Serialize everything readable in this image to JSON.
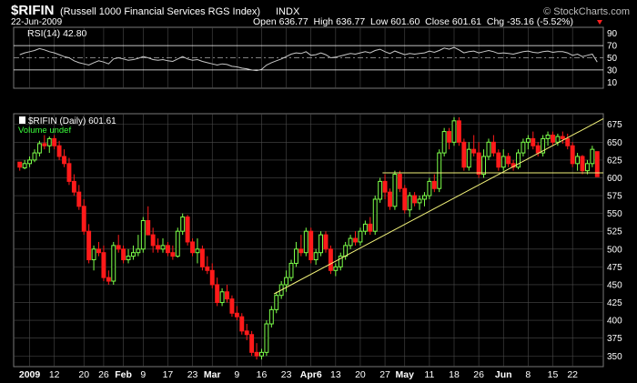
{
  "header": {
    "symbol": "$RIFIN",
    "name": "(Russell 1000 Financial Services RGS Index)",
    "exchange": "INDX",
    "watermark": "© StockCharts.com",
    "date": "22-Jun-2009",
    "quote_line": "Open 636.77  High 636.77  Low 601.60  Close 601.61  Chg -35.16 (-5.52%)"
  },
  "rsi": {
    "label": "RSI(14) 42.80",
    "levels": [
      70,
      50,
      30
    ],
    "ticks": [
      "90",
      "70",
      "50",
      "30",
      "10"
    ]
  },
  "price": {
    "label": "$RIFIN (Daily) 601.61",
    "volume_label": "Volume undef",
    "yticks": [
      "675",
      "650",
      "625",
      "600",
      "575",
      "550",
      "525",
      "500",
      "475",
      "450",
      "425",
      "400",
      "375",
      "350"
    ]
  },
  "xaxis": {
    "labels": [
      "2009",
      "12",
      "20",
      "26",
      "Feb",
      "9",
      "17",
      "23",
      "Mar",
      "9",
      "16",
      "23",
      "Apr6",
      "13",
      "20",
      "27",
      "May",
      "11",
      "18",
      "26",
      "Jun",
      "8",
      "15",
      "22"
    ],
    "bold": [
      "2009",
      "Feb",
      "Mar",
      "Apr6",
      "May",
      "Jun"
    ]
  },
  "colors": {
    "up": "#7dff4a",
    "down": "#ff1a1a",
    "grid": "#4b4b4b",
    "background": "#000000"
  },
  "chart_data": {
    "type": "candlestick",
    "title": "$RIFIN (Russell 1000 Financial Services RGS Index) INDX",
    "ylim": [
      335,
      690
    ],
    "last_close": 601.61,
    "candles": [
      [
        622,
        622,
        610,
        615
      ],
      [
        614,
        625,
        612,
        620
      ],
      [
        620,
        630,
        615,
        625
      ],
      [
        625,
        640,
        622,
        635
      ],
      [
        635,
        652,
        630,
        648
      ],
      [
        648,
        660,
        640,
        645
      ],
      [
        645,
        658,
        635,
        655
      ],
      [
        655,
        660,
        640,
        645
      ],
      [
        645,
        652,
        625,
        630
      ],
      [
        630,
        640,
        615,
        620
      ],
      [
        620,
        628,
        590,
        595
      ],
      [
        595,
        605,
        575,
        580
      ],
      [
        580,
        590,
        555,
        560
      ],
      [
        560,
        570,
        520,
        525
      ],
      [
        525,
        535,
        480,
        485
      ],
      [
        485,
        505,
        470,
        500
      ],
      [
        500,
        510,
        490,
        495
      ],
      [
        495,
        505,
        455,
        460
      ],
      [
        460,
        470,
        450,
        455
      ],
      [
        455,
        510,
        450,
        505
      ],
      [
        505,
        520,
        495,
        500
      ],
      [
        500,
        505,
        480,
        485
      ],
      [
        485,
        500,
        480,
        490
      ],
      [
        490,
        505,
        485,
        495
      ],
      [
        495,
        520,
        490,
        500
      ],
      [
        500,
        545,
        495,
        540
      ],
      [
        540,
        560,
        530,
        520
      ],
      [
        520,
        530,
        495,
        505
      ],
      [
        505,
        515,
        495,
        500
      ],
      [
        500,
        515,
        495,
        505
      ],
      [
        505,
        510,
        490,
        495
      ],
      [
        495,
        505,
        485,
        490
      ],
      [
        490,
        530,
        488,
        525
      ],
      [
        525,
        550,
        520,
        545
      ],
      [
        545,
        548,
        505,
        510
      ],
      [
        510,
        515,
        490,
        495
      ],
      [
        495,
        515,
        480,
        500
      ],
      [
        500,
        505,
        470,
        475
      ],
      [
        475,
        490,
        465,
        470
      ],
      [
        470,
        480,
        445,
        450
      ],
      [
        450,
        460,
        420,
        425
      ],
      [
        425,
        445,
        420,
        440
      ],
      [
        440,
        450,
        425,
        430
      ],
      [
        430,
        435,
        405,
        410
      ],
      [
        410,
        420,
        400,
        405
      ],
      [
        405,
        410,
        380,
        385
      ],
      [
        385,
        395,
        372,
        380
      ],
      [
        380,
        385,
        350,
        355
      ],
      [
        355,
        368,
        345,
        350
      ],
      [
        350,
        360,
        345,
        355
      ],
      [
        355,
        400,
        350,
        395
      ],
      [
        395,
        420,
        390,
        415
      ],
      [
        415,
        440,
        410,
        435
      ],
      [
        435,
        455,
        430,
        450
      ],
      [
        450,
        470,
        440,
        460
      ],
      [
        460,
        485,
        455,
        480
      ],
      [
        480,
        510,
        475,
        500
      ],
      [
        500,
        520,
        490,
        495
      ],
      [
        495,
        530,
        490,
        525
      ],
      [
        525,
        530,
        480,
        485
      ],
      [
        485,
        500,
        478,
        495
      ],
      [
        495,
        525,
        490,
        520
      ],
      [
        520,
        525,
        495,
        500
      ],
      [
        500,
        505,
        465,
        470
      ],
      [
        470,
        480,
        462,
        475
      ],
      [
        475,
        495,
        470,
        490
      ],
      [
        490,
        510,
        485,
        505
      ],
      [
        505,
        520,
        500,
        515
      ],
      [
        515,
        525,
        505,
        510
      ],
      [
        510,
        530,
        505,
        525
      ],
      [
        525,
        540,
        520,
        535
      ],
      [
        535,
        545,
        520,
        525
      ],
      [
        525,
        575,
        520,
        570
      ],
      [
        570,
        600,
        565,
        595
      ],
      [
        595,
        605,
        570,
        580
      ],
      [
        580,
        585,
        555,
        560
      ],
      [
        560,
        610,
        555,
        605
      ],
      [
        605,
        610,
        580,
        585
      ],
      [
        585,
        590,
        550,
        555
      ],
      [
        555,
        580,
        545,
        575
      ],
      [
        575,
        580,
        560,
        565
      ],
      [
        565,
        575,
        555,
        570
      ],
      [
        570,
        580,
        560,
        575
      ],
      [
        575,
        600,
        570,
        595
      ],
      [
        595,
        605,
        580,
        585
      ],
      [
        585,
        640,
        580,
        635
      ],
      [
        635,
        670,
        630,
        665
      ],
      [
        665,
        670,
        640,
        650
      ],
      [
        650,
        685,
        645,
        680
      ],
      [
        680,
        685,
        645,
        650
      ],
      [
        650,
        655,
        610,
        615
      ],
      [
        615,
        650,
        610,
        640
      ],
      [
        640,
        660,
        630,
        635
      ],
      [
        635,
        650,
        600,
        605
      ],
      [
        605,
        640,
        600,
        630
      ],
      [
        630,
        655,
        625,
        650
      ],
      [
        650,
        660,
        630,
        635
      ],
      [
        635,
        640,
        610,
        615
      ],
      [
        615,
        640,
        610,
        630
      ],
      [
        630,
        635,
        615,
        620
      ],
      [
        620,
        625,
        610,
        615
      ],
      [
        615,
        640,
        612,
        635
      ],
      [
        635,
        655,
        630,
        650
      ],
      [
        650,
        660,
        640,
        655
      ],
      [
        655,
        665,
        640,
        645
      ],
      [
        645,
        650,
        630,
        635
      ],
      [
        635,
        660,
        630,
        655
      ],
      [
        655,
        665,
        645,
        660
      ],
      [
        660,
        665,
        645,
        650
      ],
      [
        650,
        662,
        645,
        658
      ],
      [
        658,
        665,
        648,
        655
      ],
      [
        655,
        662,
        640,
        645
      ],
      [
        645,
        650,
        615,
        620
      ],
      [
        620,
        635,
        610,
        630
      ],
      [
        630,
        632,
        605,
        610
      ],
      [
        610,
        625,
        605,
        620
      ],
      [
        620,
        645,
        615,
        640
      ],
      [
        636.77,
        636.77,
        601.6,
        601.61
      ]
    ],
    "rsi_values": [
      55,
      58,
      60,
      62,
      65,
      63,
      60,
      58,
      55,
      52,
      50,
      45,
      42,
      40,
      38,
      42,
      45,
      43,
      40,
      48,
      50,
      48,
      46,
      47,
      49,
      52,
      50,
      47,
      46,
      47,
      45,
      44,
      48,
      52,
      48,
      46,
      47,
      44,
      42,
      40,
      38,
      40,
      39,
      36,
      35,
      33,
      32,
      30,
      29,
      31,
      38,
      42,
      45,
      48,
      52,
      56,
      58,
      57,
      60,
      54,
      55,
      58,
      55,
      50,
      51,
      53,
      55,
      57,
      56,
      58,
      60,
      58,
      62,
      64,
      60,
      57,
      61,
      58,
      55,
      57,
      56,
      57,
      58,
      61,
      59,
      62,
      66,
      64,
      67,
      63,
      58,
      60,
      61,
      58,
      60,
      62,
      60,
      57,
      58,
      57,
      56,
      58,
      60,
      61,
      59,
      58,
      60,
      61,
      59,
      60,
      60,
      58,
      54,
      56,
      52,
      54,
      56,
      43
    ],
    "trendlines": [
      {
        "from": [
          "Mar 19",
          437
        ],
        "to": [
          "Jun 22",
          683
        ]
      },
      {
        "from": [
          "Apr 13",
          607
        ],
        "to": [
          "Jun 22",
          607
        ]
      }
    ]
  }
}
